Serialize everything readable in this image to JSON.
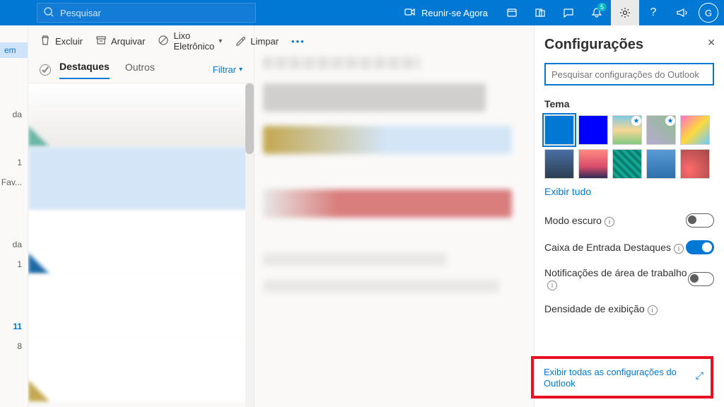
{
  "topbar": {
    "search_placeholder": "Pesquisar",
    "meet_now": "Reunir-se Agora",
    "badge": "5",
    "avatar": "G"
  },
  "leftnav": {
    "selected": "em",
    "items": [
      "da",
      "1",
      "Fav...",
      "da",
      "1",
      "11",
      "8"
    ]
  },
  "cmdbar": {
    "delete": "Excluir",
    "archive": "Arquivar",
    "junk": "Lixo Eletrônico",
    "sweep": "Limpar"
  },
  "tabs": {
    "focused": "Destaques",
    "other": "Outros",
    "filter": "Filtrar"
  },
  "settings": {
    "title": "Configurações",
    "search_placeholder": "Pesquisar configurações do Outlook",
    "theme_label": "Tema",
    "show_all": "Exibir tudo",
    "dark_mode": "Modo escuro",
    "focused_inbox": "Caixa de Entrada Destaques",
    "desktop_notif": "Notificações de área de trabalho",
    "density": "Densidade de exibição",
    "view_all": "Exibir todas as configurações do Outlook"
  }
}
